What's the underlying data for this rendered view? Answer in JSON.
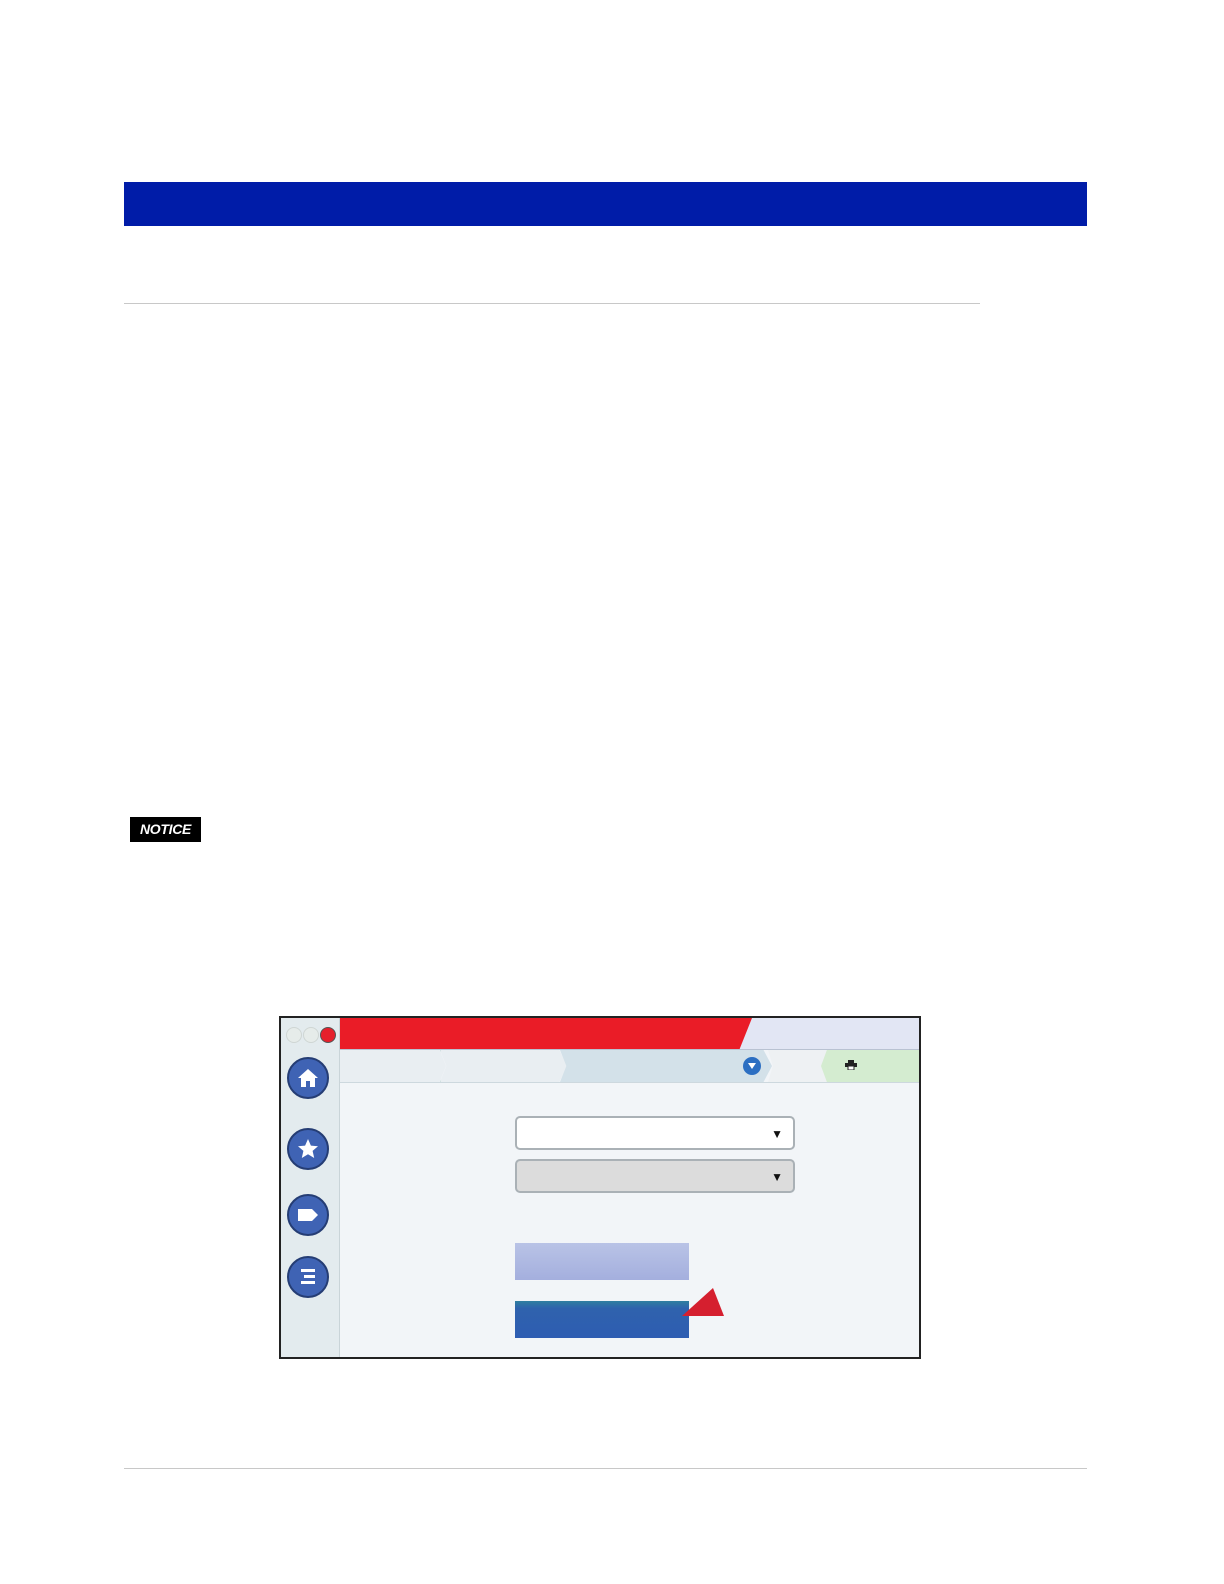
{
  "notice": {
    "label": "NOTICE"
  },
  "colors": {
    "header_bar": "#001ca8",
    "console_alarm_bar": "#ea1c27",
    "nav_button": "#3f63b4",
    "primary_button": "#2e5db2",
    "secondary_button": "#a4afde",
    "callout_pointer": "#d51f2f"
  },
  "console": {
    "nav_icons": [
      "home-icon",
      "star-icon",
      "tag-icon",
      "menu-icon"
    ],
    "breadcrumb_icons": [
      "chevron-down-icon",
      "printer-icon"
    ],
    "dropdowns": [
      {
        "state": "enabled",
        "icon": "caret-down-icon"
      },
      {
        "state": "disabled",
        "icon": "caret-down-icon"
      }
    ],
    "buttons": [
      {
        "style": "secondary"
      },
      {
        "style": "primary",
        "highlighted": true
      }
    ]
  }
}
